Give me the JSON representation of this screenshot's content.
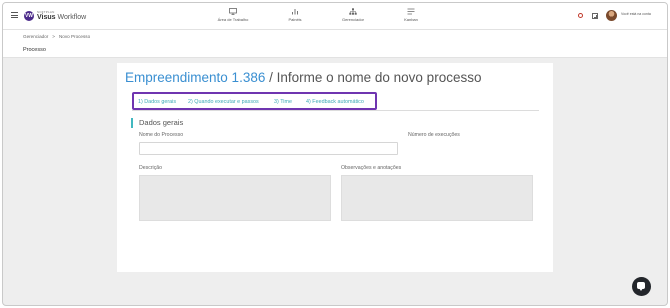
{
  "header": {
    "logo_badge": "VW",
    "logo_small": "SOFTPLAN",
    "logo_title_bold": "Visus",
    "logo_title_rest": " Workflow",
    "nav": [
      {
        "label": "Área de Trabalho",
        "icon": "monitor-icon"
      },
      {
        "label": "Painéis",
        "icon": "chart-icon"
      },
      {
        "label": "Gerenciador",
        "icon": "hierarchy-icon"
      },
      {
        "label": "Kanban",
        "icon": "kanban-icon"
      }
    ],
    "user_text": "Você está na conta"
  },
  "breadcrumb": {
    "items": [
      "Gerenciador",
      "Novo Processo"
    ],
    "separator": ">"
  },
  "page_title": "Processo",
  "form": {
    "heading_accent": "Empreendimento 1.386",
    "heading_rest": " / Informe o nome do novo processo",
    "tabs": [
      "1) Dados gerais",
      "2) Quando executar e passos",
      "3) Time",
      "4) Feedback automático"
    ],
    "section_title": "Dados gerais",
    "labels": {
      "name": "Nome do Processo",
      "executions": "Número de execuções",
      "description": "Descrição",
      "notes": "Observações e anotações"
    },
    "values": {
      "name": "",
      "description": "",
      "notes": ""
    }
  },
  "colors": {
    "accent_blue": "#3a8fd1",
    "tab_teal": "#3ca9b6",
    "highlight_purple": "#6f35b0",
    "brand_purple": "#4b2a8a"
  }
}
